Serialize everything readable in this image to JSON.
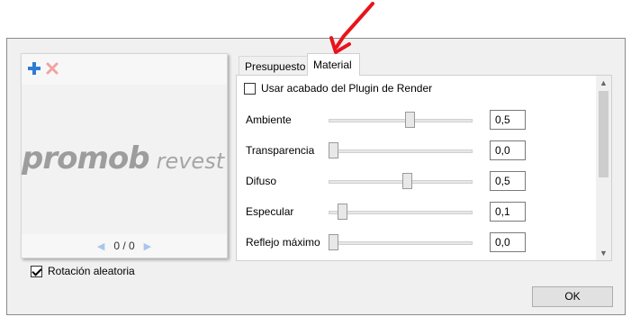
{
  "preview": {
    "brand_main": "promob",
    "brand_sub": "revest",
    "pager_text": "0 / 0",
    "toolbar": {
      "add_icon": "plus-icon",
      "delete_icon": "x-icon"
    }
  },
  "random_rotation": {
    "label": "Rotación aleatoria",
    "checked": true
  },
  "tabs": [
    {
      "label": "Presupuesto",
      "active": false
    },
    {
      "label": "Material",
      "active": true
    }
  ],
  "material": {
    "use_plugin_label": "Usar acabado del Plugin de Render",
    "use_plugin_checked": false,
    "properties": [
      {
        "label": "Ambiente",
        "value": "0,5",
        "level": 0.5
      },
      {
        "label": "Transparencia",
        "value": "0,0",
        "level": 0.0
      },
      {
        "label": "Difuso",
        "value": "0,5",
        "level": 0.5
      },
      {
        "label": "Especular",
        "value": "0,1",
        "level": 0.1
      },
      {
        "label": "Reflejo máximo",
        "value": "0,0",
        "level": 0.0
      }
    ]
  },
  "ok_label": "OK",
  "colors": {
    "annotation_arrow": "#e8141b",
    "add_icon": "#2f7bd4",
    "delete_icon": "#f0a3a3"
  }
}
